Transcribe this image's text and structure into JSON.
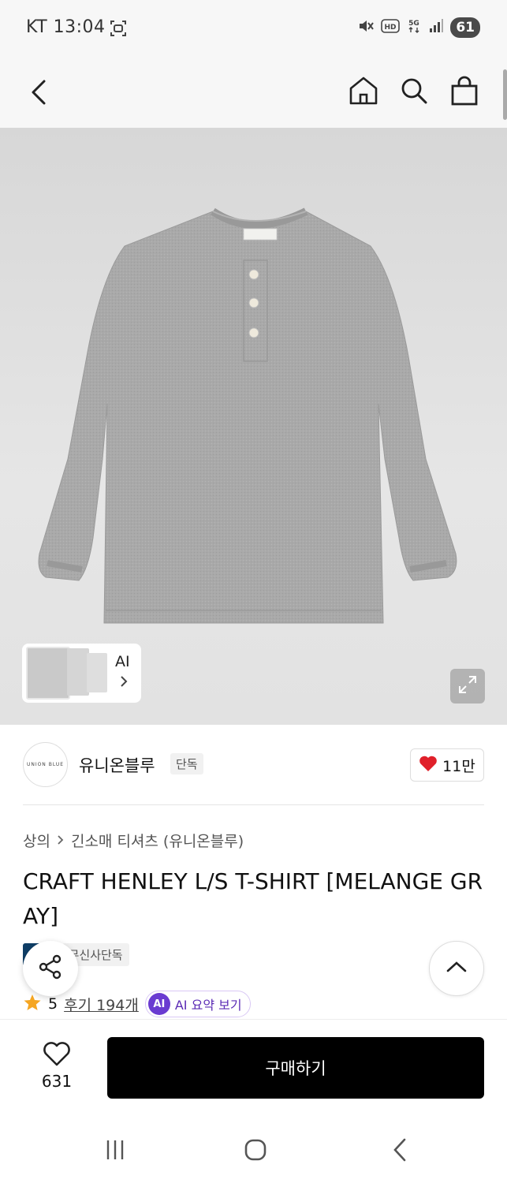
{
  "status_bar": {
    "carrier_time": "KT 13:04",
    "battery": "61"
  },
  "brand": {
    "logo_text": "UNION BLUE",
    "name": "유니온블루",
    "tag": "단독",
    "likes": "11만"
  },
  "thumbnails": {
    "ai_label": "AI"
  },
  "breadcrumb": {
    "category": "상의",
    "subcategory": "긴소매 티셔츠 (유니온블루)"
  },
  "product": {
    "title": "CRAFT HENLEY L/S T-SHIRT [MELANGE GRAY]",
    "badges": [
      "페이",
      "무신사단독"
    ],
    "rating": "5",
    "review_link": "후기 194개",
    "ai_summary": {
      "badge": "AI",
      "label": "AI 요약 보기"
    }
  },
  "bottom_bar": {
    "wish_count": "631",
    "buy_label": "구매하기"
  },
  "colors": {
    "shirt": "#a8a8a8",
    "badge_dark": "#0f3e66",
    "heart": "#e0202a",
    "star": "#f5a623",
    "ai_purple": "#6a3bd1"
  }
}
